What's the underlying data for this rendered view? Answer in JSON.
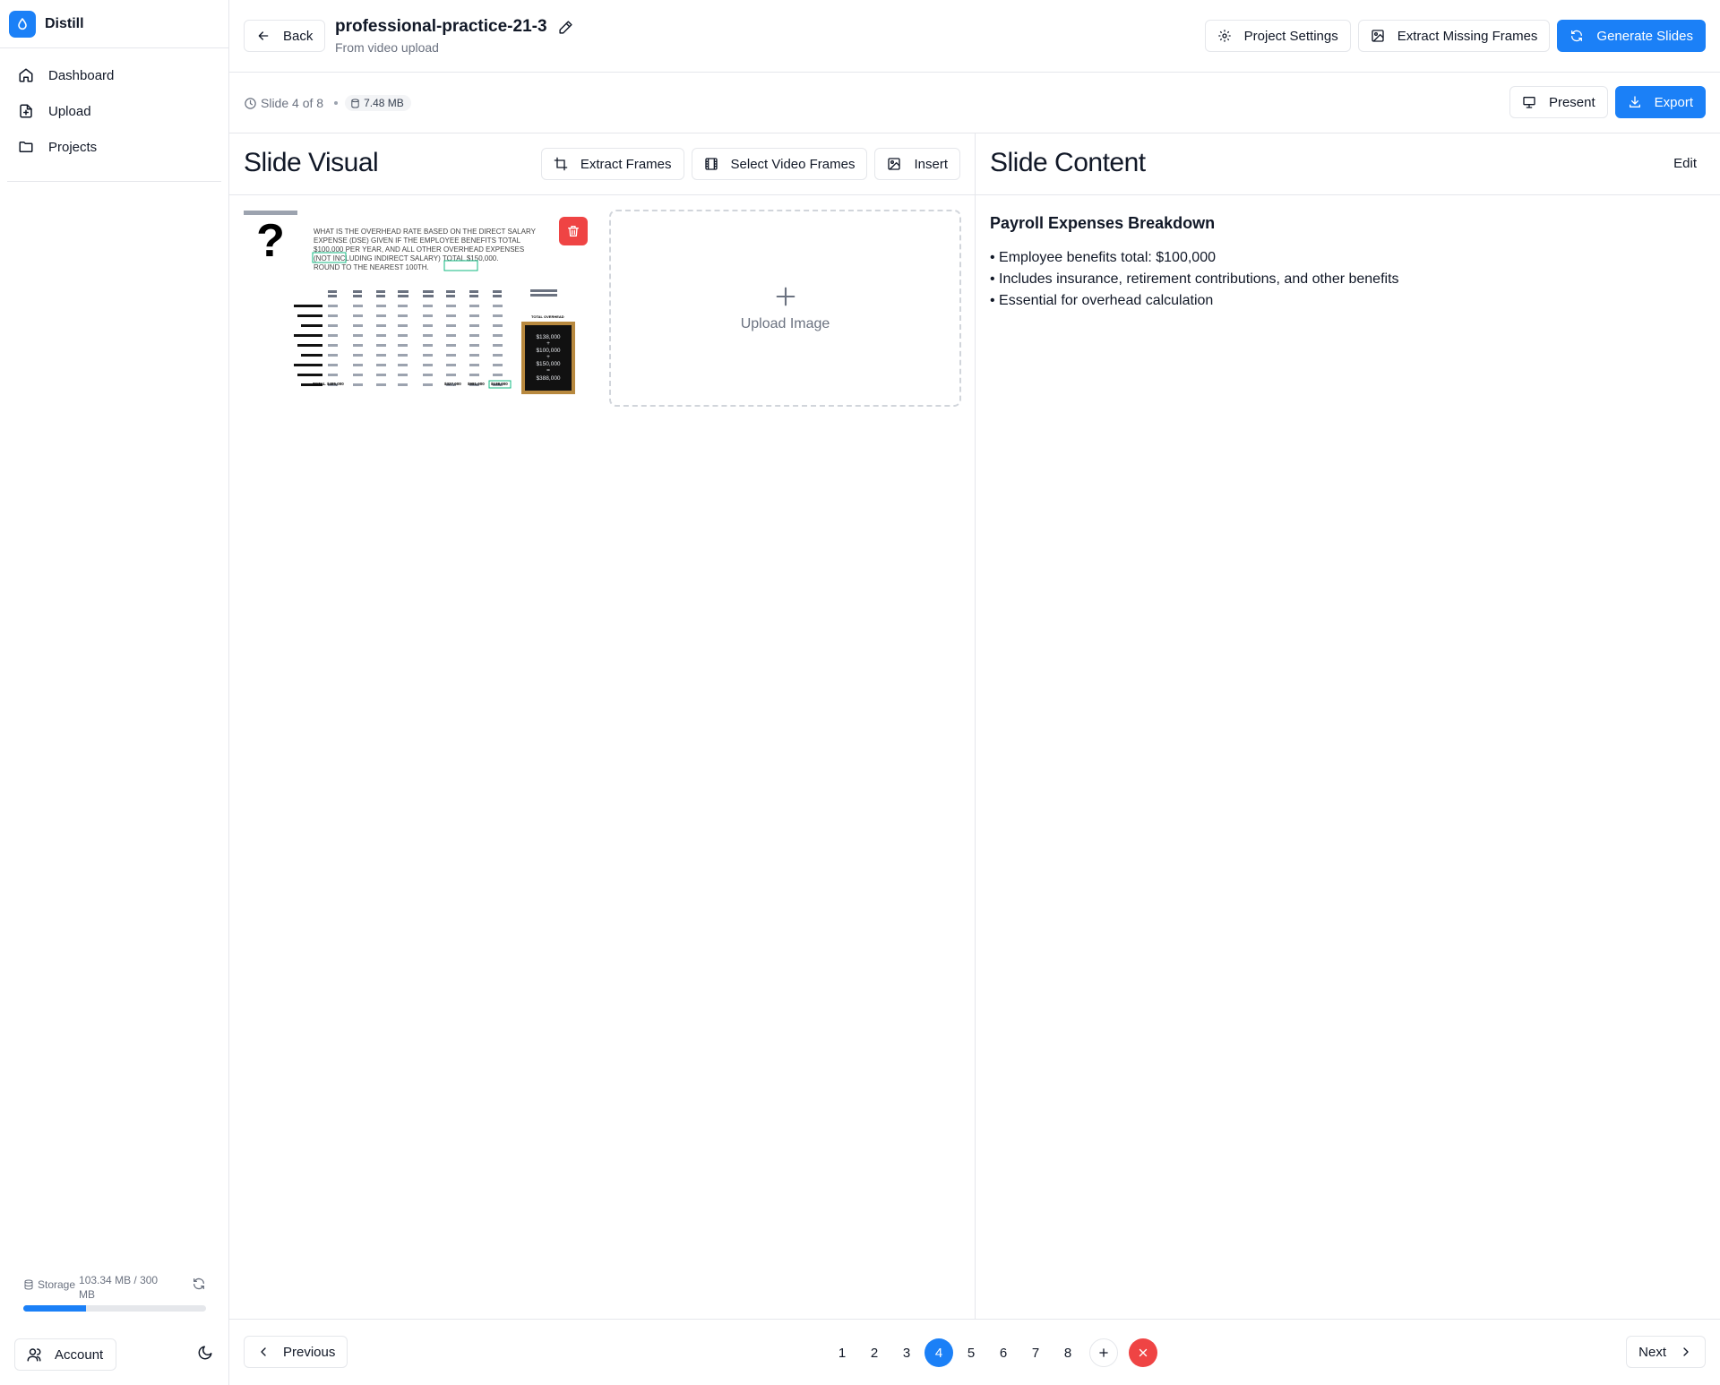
{
  "app": {
    "name": "Distill",
    "accent": "#1b80f7",
    "danger": "#ef4444"
  },
  "sidebar": {
    "items": [
      {
        "label": "Dashboard",
        "icon": "home-icon"
      },
      {
        "label": "Upload",
        "icon": "file-upload-icon"
      },
      {
        "label": "Projects",
        "icon": "folder-icon"
      }
    ],
    "storage": {
      "label": "Storage",
      "amount": "103.34 MB / 300 MB",
      "used_fraction": 0.344
    },
    "account_label": "Account"
  },
  "header": {
    "back_label": "Back",
    "project_title": "professional-practice-21-3",
    "project_subtitle": "From video upload",
    "settings_label": "Project Settings",
    "extract_missing_label": "Extract Missing Frames",
    "generate_label": "Generate Slides"
  },
  "slidebar": {
    "position": "Slide 4 of 8",
    "size": "7.48 MB",
    "present_label": "Present",
    "export_label": "Export"
  },
  "visual": {
    "title": "Slide Visual",
    "extract_frames_label": "Extract Frames",
    "select_video_frames_label": "Select Video Frames",
    "insert_label": "Insert",
    "upload_label": "Upload Image"
  },
  "content": {
    "title": "Slide Content",
    "edit_label": "Edit",
    "heading": "Payroll Expenses Breakdown",
    "bullets": [
      "• Employee benefits total: $100,000",
      "• Includes insurance, retirement contributions, and other benefits",
      "• Essential for overhead calculation"
    ]
  },
  "footer": {
    "previous_label": "Previous",
    "next_label": "Next",
    "pages": [
      "1",
      "2",
      "3",
      "4",
      "5",
      "6",
      "7",
      "8"
    ],
    "current_page": "4"
  },
  "thumbnail": {
    "question_text": [
      "WHAT IS THE OVERHEAD RATE BASED ON THE DIRECT SALARY",
      "EXPENSE (DSE) GIVEN IF THE EMPLOYEE BENEFITS TOTAL",
      "$100,000 PER YEAR, AND ALL OTHER OVERHEAD EXPENSES",
      "(NOT INCLUDING INDIRECT SALARY) TOTAL $150,000.",
      "ROUND TO THE NEAREST 100TH."
    ],
    "board_lines": [
      "$138,000",
      "+",
      "$100,000",
      "+",
      "$150,000",
      "=",
      "$388,000"
    ],
    "total_overhead_label": "TOTAL OVERHEAD",
    "total_row": [
      "TOTAL",
      "$485,000",
      "$327,000",
      "$981,000",
      "$138,000"
    ]
  }
}
